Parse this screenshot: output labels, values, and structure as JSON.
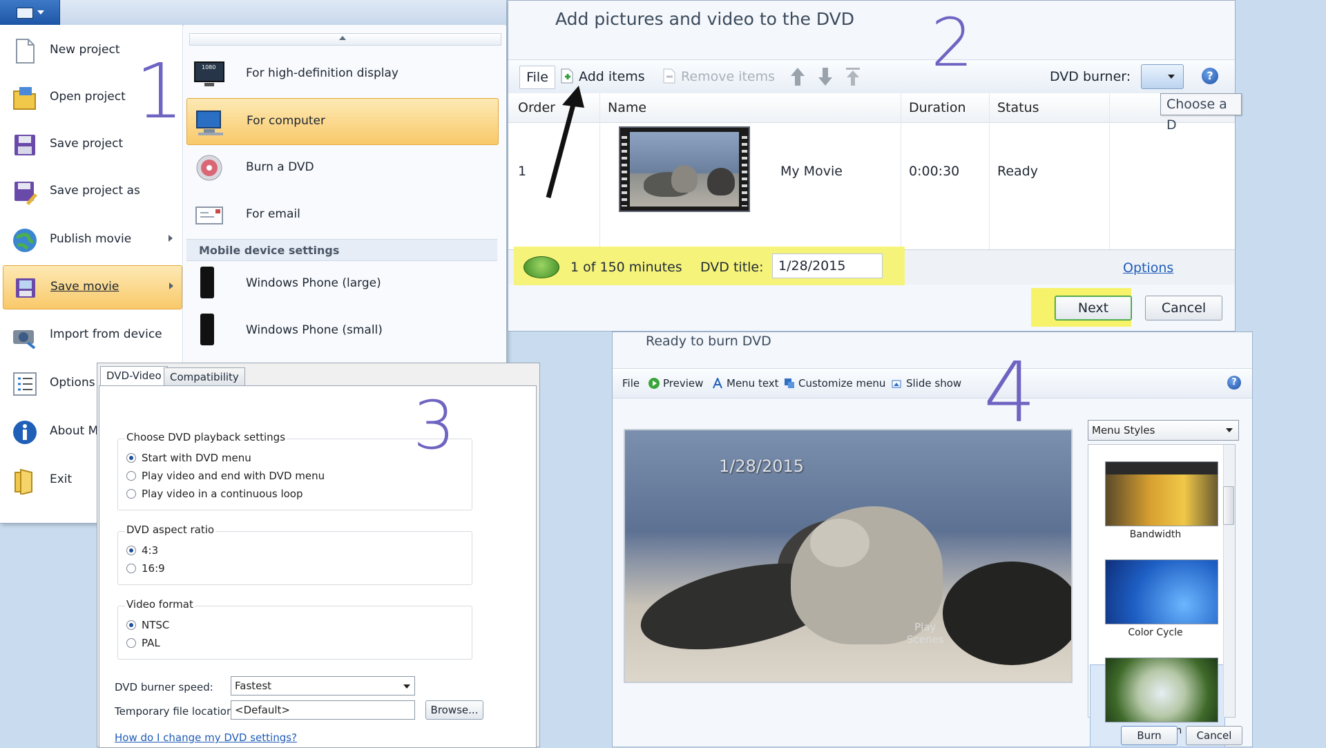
{
  "annotations": {
    "n1": "1",
    "n2": "2",
    "n3": "3",
    "n4": "4"
  },
  "panel1": {
    "main_items": [
      {
        "label": "New project",
        "icon": "new-project-icon"
      },
      {
        "label": "Open project",
        "icon": "open-folder-icon"
      },
      {
        "label": "Save project",
        "icon": "floppy-disk-icon"
      },
      {
        "label": "Save project as",
        "icon": "save-as-icon"
      },
      {
        "label": "Publish movie",
        "icon": "globe-icon"
      },
      {
        "label": "Save movie",
        "icon": "save-movie-icon"
      },
      {
        "label": "Import from device",
        "icon": "camera-icon"
      },
      {
        "label": "Options",
        "icon": "options-list-icon"
      },
      {
        "label": "About M",
        "icon": "info-icon"
      },
      {
        "label": "Exit",
        "icon": "exit-icon"
      }
    ],
    "sub_items": [
      {
        "label": "For high-definition display",
        "icon": "hd-display-icon"
      },
      {
        "label": "For computer",
        "icon": "computer-icon"
      },
      {
        "label": "Burn a DVD",
        "icon": "dvd-disc-icon"
      },
      {
        "label": "For email",
        "icon": "email-icon"
      }
    ],
    "section_header": "Mobile device settings",
    "mobile_items": [
      {
        "label": "Windows Phone (large)",
        "icon": "phone-icon"
      },
      {
        "label": "Windows Phone (small)",
        "icon": "phone-icon"
      }
    ]
  },
  "panel2": {
    "title": "Add pictures and video to the DVD",
    "toolbar": {
      "file": "File",
      "add": "Add items",
      "remove": "Remove items",
      "burner_label": "DVD burner:",
      "tooltip": "Choose a D"
    },
    "columns": [
      "Order",
      "Name",
      "Duration",
      "Status"
    ],
    "row": {
      "order": "1",
      "name": "My Movie",
      "duration": "0:00:30",
      "status": "Ready"
    },
    "status": {
      "minutes": "1 of 150 minutes",
      "dvd_title_label": "DVD title:",
      "dvd_title_value": "1/28/2015",
      "options": "Options"
    },
    "buttons": {
      "next": "Next",
      "cancel": "Cancel"
    },
    "highlight_color": "#f6f36b"
  },
  "panel3": {
    "tabs": [
      "DVD-Video",
      "Compatibility"
    ],
    "playback": {
      "title": "Choose DVD playback settings",
      "options": [
        "Start with DVD menu",
        "Play video and end with DVD menu",
        "Play video in a continuous loop"
      ],
      "selected": 0
    },
    "aspect": {
      "title": "DVD aspect ratio",
      "options": [
        "4:3",
        "16:9"
      ],
      "selected": 0
    },
    "format": {
      "title": "Video format",
      "options": [
        "NTSC",
        "PAL"
      ],
      "selected": 0
    },
    "speed": {
      "label": "DVD burner speed:",
      "value": "Fastest"
    },
    "temp": {
      "label": "Temporary file location:",
      "value": "<Default>",
      "browse": "Browse..."
    },
    "help_link": "How do I change my DVD settings?"
  },
  "panel4": {
    "title": "Ready to burn DVD",
    "toolbar": {
      "file": "File",
      "preview": "Preview",
      "menu_text": "Menu text",
      "customize": "Customize menu",
      "slideshow": "Slide show"
    },
    "preview": {
      "date": "1/28/2015",
      "play": "Play",
      "scenes": "Scenes"
    },
    "styles_dropdown": "Menu Styles",
    "styles": [
      "Bandwidth",
      "Color Cycle",
      "Full Screen"
    ],
    "buttons": {
      "burn": "Burn",
      "cancel": "Cancel"
    }
  }
}
